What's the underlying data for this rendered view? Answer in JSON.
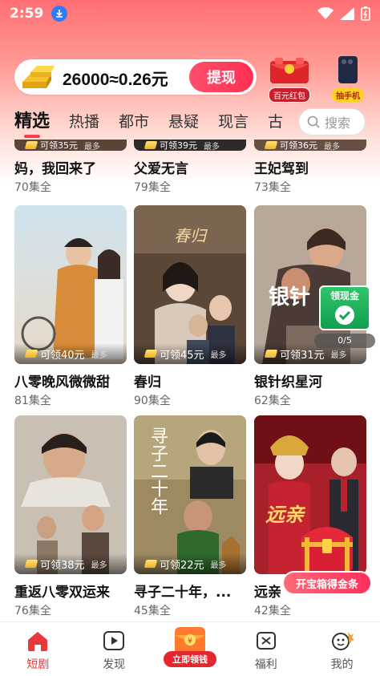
{
  "status_bar": {
    "time": "2:59"
  },
  "reward_bar": {
    "amount_text": "26000≈0.26元",
    "withdraw_label": "提现"
  },
  "promos": [
    {
      "label": "百元红包",
      "icon": "red-envelope-icon"
    },
    {
      "label": "抽手机",
      "icon": "phone-prize-icon"
    }
  ],
  "tabs": [
    {
      "label": "精选",
      "active": true
    },
    {
      "label": "热播"
    },
    {
      "label": "都市"
    },
    {
      "label": "悬疑"
    },
    {
      "label": "现言"
    },
    {
      "label": "古"
    }
  ],
  "search": {
    "placeholder": "搜索"
  },
  "partial_row": [
    {
      "title": "妈，我回来了",
      "episodes": "70集全",
      "reward": "可领35元",
      "more": "最多"
    },
    {
      "title": "父爱无言",
      "episodes": "79集全",
      "reward": "可领39元",
      "more": "最多"
    },
    {
      "title": "王妃驾到",
      "episodes": "73集全",
      "reward": "可领36元",
      "more": "最多"
    }
  ],
  "rows": [
    [
      {
        "title": "八零晚风微微甜",
        "episodes": "81集全",
        "reward": "可领40元",
        "more": "最多"
      },
      {
        "title": "春归",
        "episodes": "90集全",
        "reward": "可领45元",
        "more": "最多",
        "poster_text": "春归"
      },
      {
        "title": "银针织星河",
        "episodes": "62集全",
        "reward": "可领31元",
        "more": "最多",
        "poster_text": "银针"
      }
    ],
    [
      {
        "title": "重返八零双运来",
        "episodes": "76集全",
        "reward": "可领38元",
        "more": "最多"
      },
      {
        "title": "寻子二十年，...",
        "episodes": "45集全",
        "reward": "可领22元",
        "more": "最多",
        "poster_text": "寻子二十年"
      },
      {
        "title": "远亲",
        "episodes": "42集全",
        "reward": "",
        "more": "",
        "poster_text": "远亲"
      }
    ]
  ],
  "bonus_widget": {
    "label": "领现金",
    "progress": "0/5"
  },
  "chest_widget": {
    "label": "开宝箱得金条"
  },
  "bottom_nav": [
    {
      "label": "短剧",
      "active": true,
      "icon": "home-icon"
    },
    {
      "label": "发现",
      "icon": "play-icon"
    },
    {
      "label": "立即领钱",
      "icon": "cash-envelope-icon"
    },
    {
      "label": "福利",
      "icon": "gift-icon"
    },
    {
      "label": "我的",
      "icon": "profile-icon"
    }
  ],
  "colors": {
    "accent": "#e8383d",
    "withdraw": "#ff2f52",
    "header_gradient_top": "#ff6f73"
  }
}
